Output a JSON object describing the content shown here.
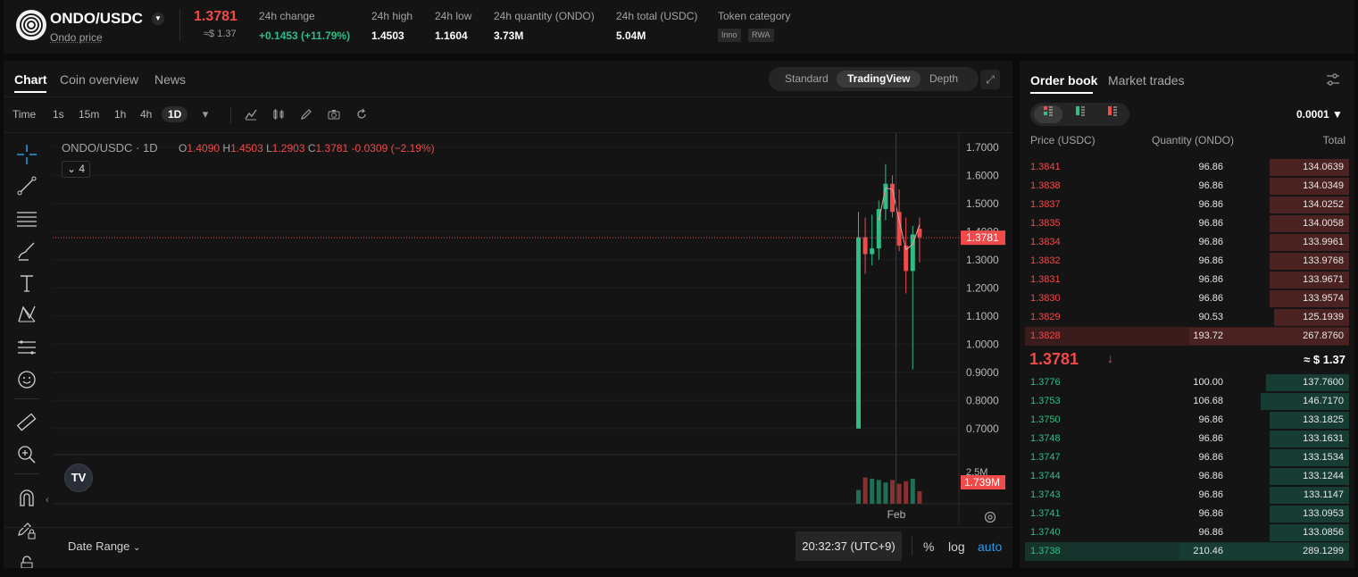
{
  "header": {
    "pair": "ONDO/USDC",
    "subtitle": "Ondo price",
    "last_price": "1.3781",
    "last_price_usd": "≈$ 1.37",
    "stats": [
      {
        "label": "24h change",
        "value": "+0.1453 (+11.79%)"
      },
      {
        "label": "24h high",
        "value": "1.4503"
      },
      {
        "label": "24h low",
        "value": "1.1604"
      },
      {
        "label": "24h quantity (ONDO)",
        "value": "3.73M"
      },
      {
        "label": "24h total (USDC)",
        "value": "5.04M"
      }
    ],
    "token_category_label": "Token category",
    "tags": [
      "Inno",
      "RWA"
    ]
  },
  "chart_panel": {
    "tabs": [
      "Chart",
      "Coin overview",
      "News"
    ],
    "views": [
      "Standard",
      "TradingView",
      "Depth"
    ],
    "active_view": "TradingView",
    "timeframes": [
      "Time",
      "1s",
      "15m",
      "1h",
      "4h",
      "1D"
    ],
    "active_timeframe": "1D",
    "legend_title": "ONDO/USDC · 1D",
    "legend": {
      "o": "1.4090",
      "h": "1.4503",
      "l": "1.2903",
      "c": "1.3781",
      "chg": "-0.0309 (−2.19%)"
    },
    "indicator_count": "4",
    "tv_logo": "TV",
    "date_range_label": "Date Range",
    "clock": "20:32:37 (UTC+9)",
    "bottom_options": [
      "%",
      "log",
      "auto"
    ],
    "price_axis_labels": [
      "1.7000",
      "1.6000",
      "1.5000",
      "1.4000",
      "1.3000",
      "1.2000",
      "1.1000",
      "1.0000",
      "0.9000",
      "0.8000",
      "0.7000"
    ],
    "current_price_tag": "1.3781",
    "volume_axis_label": "2.5M",
    "volume_tag": "1.739M",
    "time_label": "Feb",
    "colors": {
      "up": "#2ebd85",
      "down": "#f04a4a"
    }
  },
  "chart_data": {
    "type": "candlestick",
    "y_ticks": [
      0.7,
      0.8,
      0.9,
      1.0,
      1.1,
      1.2,
      1.3,
      1.4,
      1.5,
      1.6,
      1.7
    ],
    "ylim": [
      0.62,
      1.75
    ],
    "candles": [
      {
        "o": 0.7,
        "h": 1.47,
        "l": 0.7,
        "c": 1.38,
        "v": 1.1
      },
      {
        "o": 1.38,
        "h": 1.45,
        "l": 1.25,
        "c": 1.32,
        "v": 2.1
      },
      {
        "o": 1.32,
        "h": 1.46,
        "l": 1.28,
        "c": 1.34,
        "v": 2.0
      },
      {
        "o": 1.34,
        "h": 1.51,
        "l": 1.3,
        "c": 1.48,
        "v": 1.9
      },
      {
        "o": 1.48,
        "h": 1.64,
        "l": 1.44,
        "c": 1.57,
        "v": 1.7
      },
      {
        "o": 1.57,
        "h": 1.6,
        "l": 1.45,
        "c": 1.47,
        "v": 1.9
      },
      {
        "o": 1.47,
        "h": 1.55,
        "l": 1.33,
        "c": 1.35,
        "v": 1.6
      },
      {
        "o": 1.35,
        "h": 1.45,
        "l": 1.18,
        "c": 1.26,
        "v": 1.8
      },
      {
        "o": 1.26,
        "h": 1.42,
        "l": 0.91,
        "c": 1.39,
        "v": 2.0
      },
      {
        "o": 1.41,
        "h": 1.45,
        "l": 1.29,
        "c": 1.38,
        "v": 1.0
      }
    ],
    "current_price": 1.3781
  },
  "order_book": {
    "tabs": [
      "Order book",
      "Market trades"
    ],
    "precision": "0.0001",
    "headers": [
      "Price (USDC)",
      "Quantity (ONDO)",
      "Total"
    ],
    "asks": [
      {
        "price": "1.3841",
        "qty": "96.86",
        "total": "134.0639",
        "depth": 0.47
      },
      {
        "price": "1.3838",
        "qty": "96.86",
        "total": "134.0349",
        "depth": 0.47
      },
      {
        "price": "1.3837",
        "qty": "96.86",
        "total": "134.0252",
        "depth": 0.47
      },
      {
        "price": "1.3835",
        "qty": "96.86",
        "total": "134.0058",
        "depth": 0.47
      },
      {
        "price": "1.3834",
        "qty": "96.86",
        "total": "133.9961",
        "depth": 0.47
      },
      {
        "price": "1.3832",
        "qty": "96.86",
        "total": "133.9768",
        "depth": 0.47
      },
      {
        "price": "1.3831",
        "qty": "96.86",
        "total": "133.9671",
        "depth": 0.47
      },
      {
        "price": "1.3830",
        "qty": "96.86",
        "total": "133.9574",
        "depth": 0.47
      },
      {
        "price": "1.3829",
        "qty": "90.53",
        "total": "125.1939",
        "depth": 0.44
      },
      {
        "price": "1.3828",
        "qty": "193.72",
        "total": "267.8760",
        "depth": 0.94
      }
    ],
    "mid_price": "1.3781",
    "mid_usd": "≈ $ 1.37",
    "bids": [
      {
        "price": "1.3776",
        "qty": "100.00",
        "total": "137.7600",
        "depth": 0.49
      },
      {
        "price": "1.3753",
        "qty": "106.68",
        "total": "146.7170",
        "depth": 0.52
      },
      {
        "price": "1.3750",
        "qty": "96.86",
        "total": "133.1825",
        "depth": 0.47
      },
      {
        "price": "1.3748",
        "qty": "96.86",
        "total": "133.1631",
        "depth": 0.47
      },
      {
        "price": "1.3747",
        "qty": "96.86",
        "total": "133.1534",
        "depth": 0.47
      },
      {
        "price": "1.3744",
        "qty": "96.86",
        "total": "133.1244",
        "depth": 0.47
      },
      {
        "price": "1.3743",
        "qty": "96.86",
        "total": "133.1147",
        "depth": 0.47
      },
      {
        "price": "1.3741",
        "qty": "96.86",
        "total": "133.0953",
        "depth": 0.47
      },
      {
        "price": "1.3740",
        "qty": "96.86",
        "total": "133.0856",
        "depth": 0.47
      },
      {
        "price": "1.3738",
        "qty": "210.46",
        "total": "289.1299",
        "depth": 1.0
      }
    ]
  }
}
